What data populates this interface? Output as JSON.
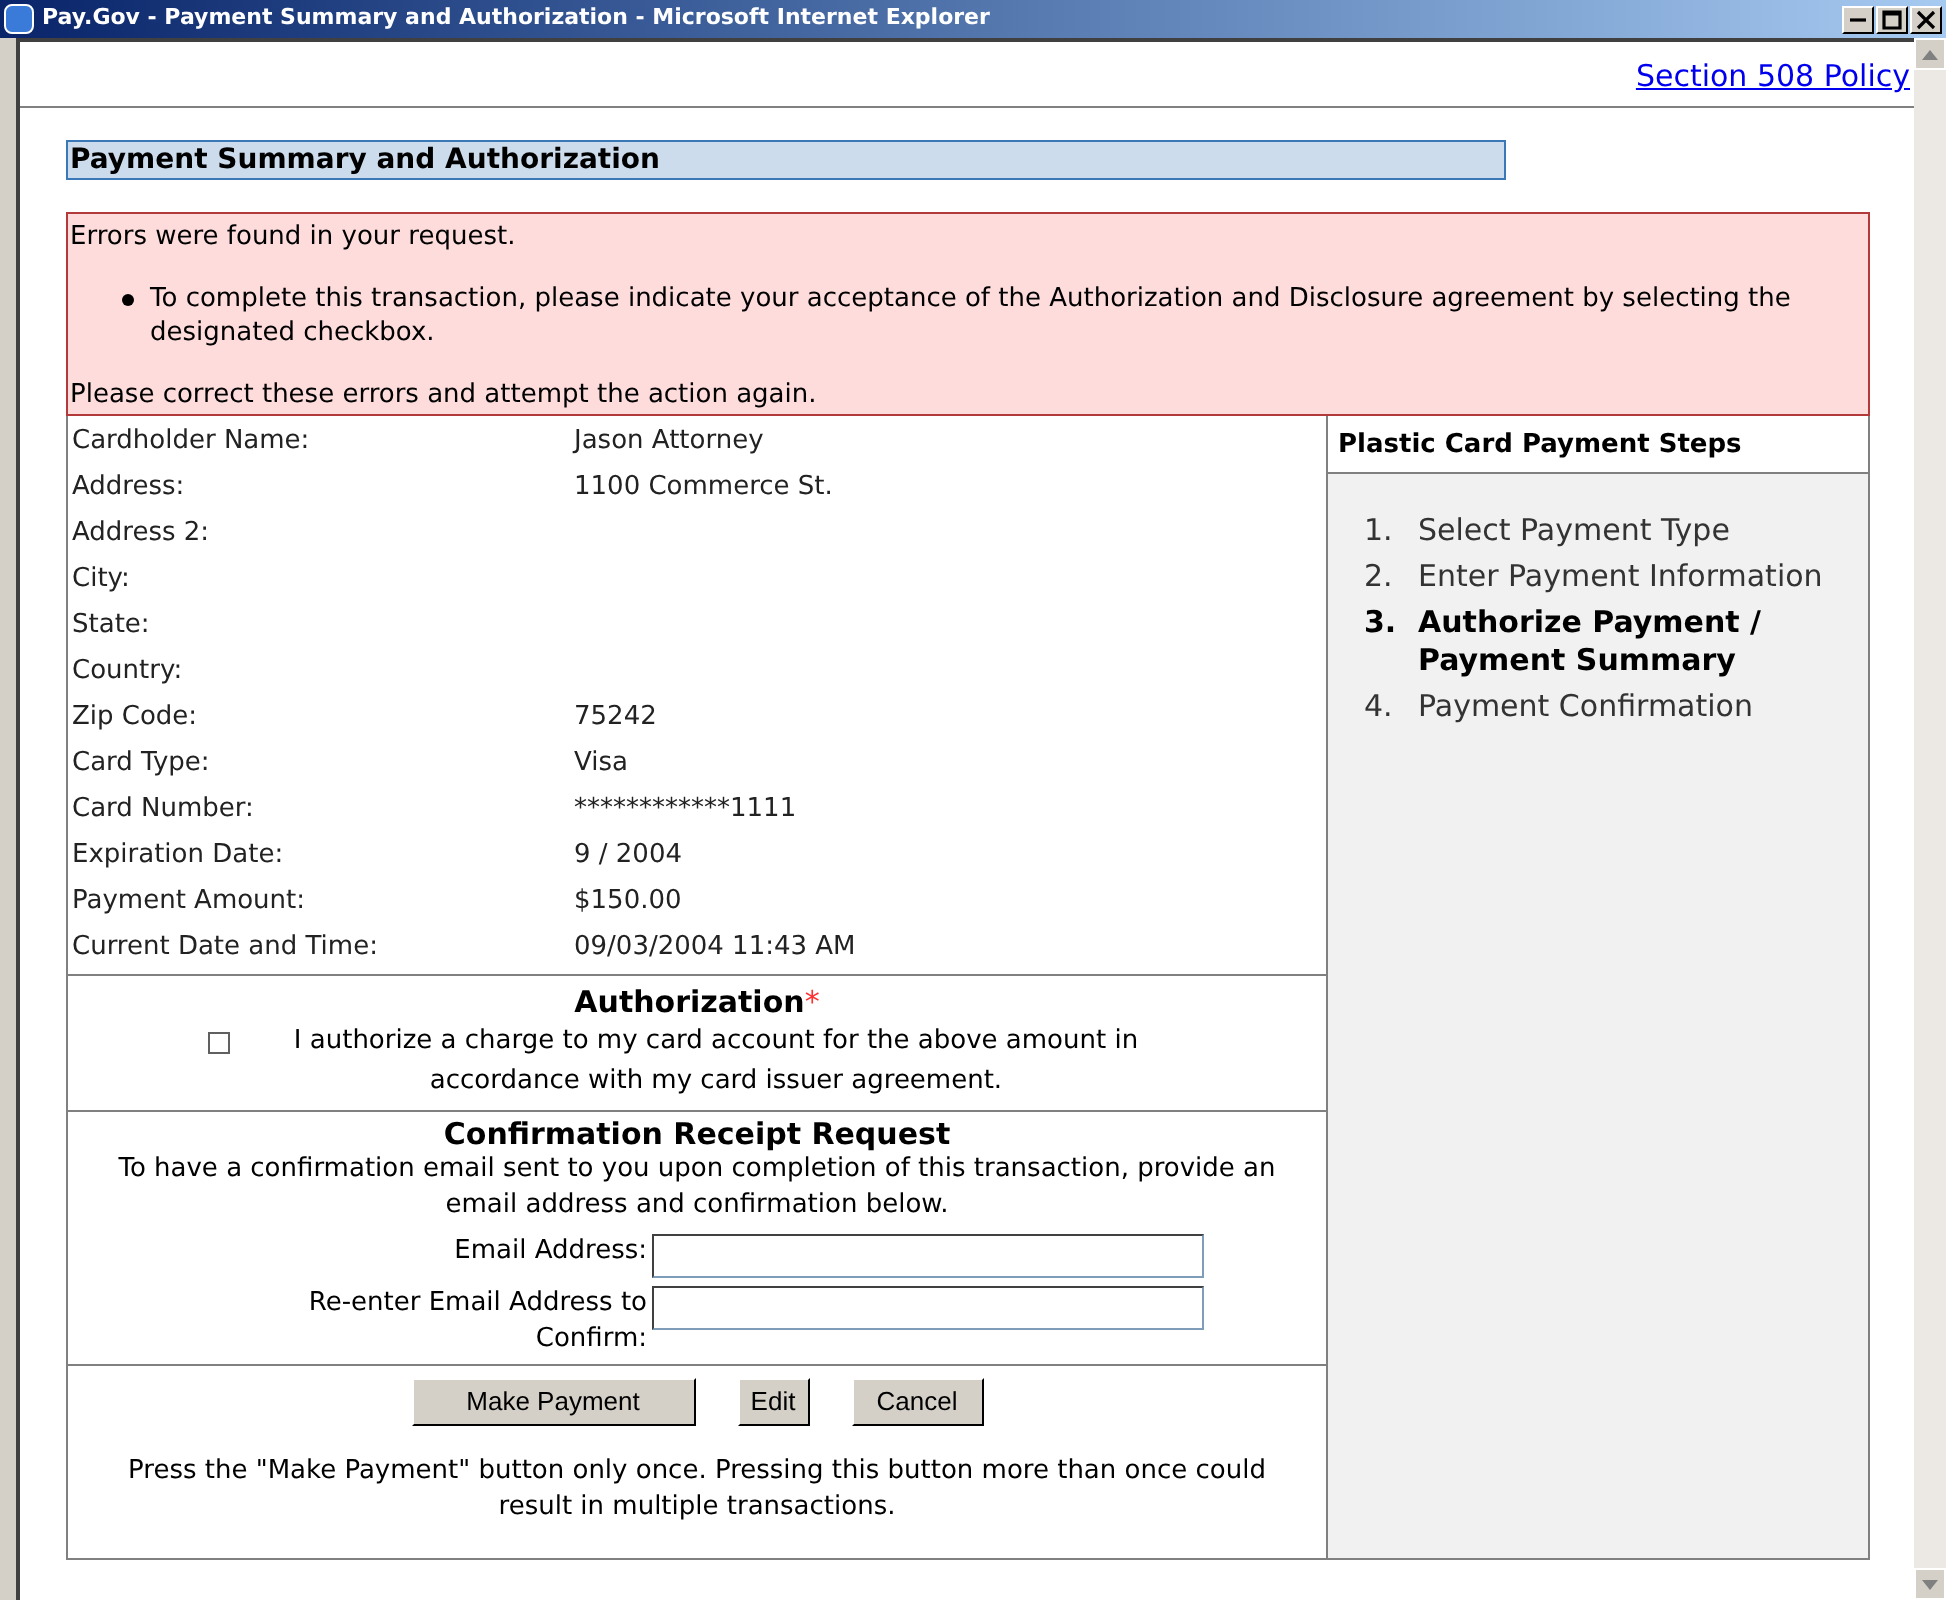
{
  "window": {
    "title": "Pay.Gov - Payment Summary and Authorization - Microsoft Internet Explorer"
  },
  "top_link": "Section 508 Policy",
  "heading": "Payment Summary and Authorization",
  "errors": {
    "intro": "Errors were found in your request.",
    "items": [
      "To complete this transaction, please indicate your acceptance of the Authorization and Disclosure agreement by selecting the designated checkbox."
    ],
    "footer": "Please correct these errors and attempt the action again."
  },
  "summary": [
    {
      "label": "Cardholder Name:",
      "value": "Jason Attorney"
    },
    {
      "label": "Address:",
      "value": "1100 Commerce St."
    },
    {
      "label": "Address 2:"
    },
    {
      "label": "City:"
    },
    {
      "label": "State:"
    },
    {
      "label": "Country:"
    },
    {
      "label": "Zip Code:",
      "value": "75242"
    },
    {
      "label": "Card Type:",
      "value": "Visa"
    },
    {
      "label": "Card Number:",
      "value": "************1111"
    },
    {
      "label": "Expiration Date:",
      "value": "9 / 2004"
    },
    {
      "label": "Payment Amount:",
      "value": "$150.00"
    },
    {
      "label": "Current Date and Time:",
      "value": "09/03/2004 11:43 AM"
    }
  ],
  "authorization": {
    "title": "Authorization",
    "required_mark": "*",
    "checked": false,
    "text": "I authorize a charge to my card account for the above amount in accordance with my card issuer agreement."
  },
  "receipt": {
    "title": "Confirmation Receipt Request",
    "text": "To have a confirmation email sent to you upon completion of this transaction, provide an email address and confirmation below.",
    "fields": [
      {
        "label": "Email Address:"
      },
      {
        "label": "Re-enter Email Address to Confirm:"
      }
    ]
  },
  "buttons": [
    "Make Payment",
    "Edit",
    "Cancel"
  ],
  "notice": "Press the \"Make Payment\" button only once. Pressing this button more than once could result in multiple transactions.",
  "steps": {
    "title": "Plastic Card Payment Steps",
    "items": [
      {
        "number": "1.",
        "label": "Select Payment Type",
        "selected": false
      },
      {
        "number": "2.",
        "label": "Enter Payment Information",
        "selected": false
      },
      {
        "number": "3.",
        "label": "Authorize Payment / Payment Summary",
        "selected": true
      },
      {
        "number": "4.",
        "label": "Payment Confirmation",
        "selected": false
      }
    ]
  }
}
